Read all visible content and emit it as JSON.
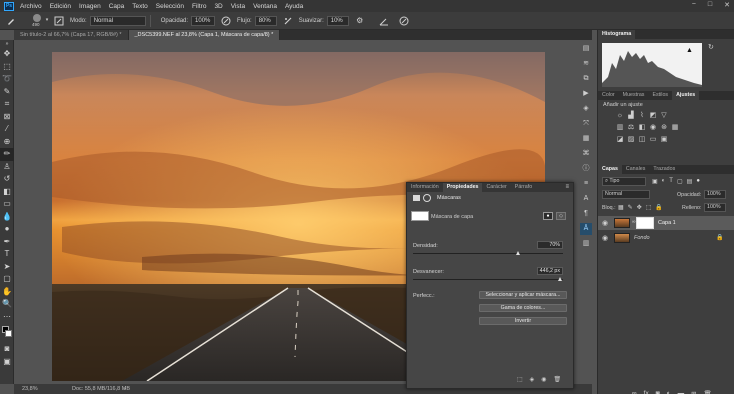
{
  "app": {
    "logo": "Ps",
    "menu": [
      "Archivo",
      "Edición",
      "Imagen",
      "Capa",
      "Texto",
      "Selección",
      "Filtro",
      "3D",
      "Vista",
      "Ventana",
      "Ayuda"
    ],
    "window_controls": [
      "−",
      "□",
      "✕"
    ]
  },
  "options": {
    "brush_size": "490",
    "mode_label": "Modo:",
    "mode_value": "Normal",
    "opacity_label": "Opacidad:",
    "opacity_value": "100%",
    "flow_label": "Flujo:",
    "flow_value": "80%",
    "smooth_label": "Suavizar:",
    "smooth_value": "10%"
  },
  "doc_tabs": [
    {
      "label": "Sin título-2 al 66,7% (Capa 17, RGB/8#) *",
      "active": false
    },
    {
      "label": "_DSC5399.NEF al 23,8% (Capa 1, Máscara de capa/8) *",
      "active": true
    }
  ],
  "status": {
    "zoom": "23,8%",
    "doc_info": "Doc: 55,8 MB/116,8 MB"
  },
  "histogram_panel": {
    "tab": "Histograma"
  },
  "adjust_panel": {
    "tabs": [
      "Color",
      "Muestras",
      "Estilos",
      "Ajustes"
    ],
    "active_tab": "Ajustes",
    "heading": "Añadir un ajuste"
  },
  "layers_panel": {
    "tabs": [
      "Capas",
      "Canales",
      "Trazados"
    ],
    "active_tab": "Capas",
    "filter_value": "Tipo",
    "blend_mode": "Normal",
    "opacity_label": "Opacidad:",
    "opacity_value": "100%",
    "lock_label": "Bloq.:",
    "fill_label": "Relleno:",
    "fill_value": "100%",
    "layers": [
      {
        "name": "Capa 1",
        "selected": true,
        "has_mask": true
      },
      {
        "name": "Fondo",
        "selected": false,
        "has_mask": false
      }
    ]
  },
  "properties_panel": {
    "tabs": [
      "Información",
      "Propiedades",
      "Carácter",
      "Párrafo"
    ],
    "active_tab": "Propiedades",
    "section_title": "Máscaras",
    "mask_label": "Máscara de capa",
    "density_label": "Densidad:",
    "density_value": "70%",
    "density_fraction": 0.7,
    "feather_label": "Desvanecer:",
    "feather_value": "446,2 px",
    "feather_fraction": 0.98,
    "refine_label": "Perfecc.:",
    "buttons": [
      "Seleccionar y aplicar máscara...",
      "Gama de colores...",
      "Invertir"
    ]
  },
  "colors": {
    "accent": "#31a8ff",
    "panel_bg": "#3e3e3e",
    "workspace_bg": "#535353"
  }
}
